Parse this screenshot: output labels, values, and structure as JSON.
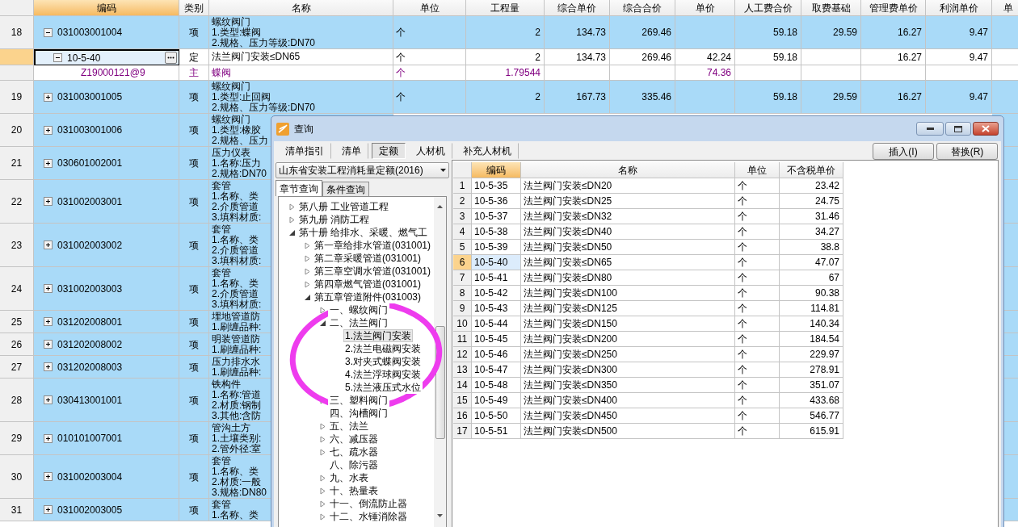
{
  "table": {
    "columns": [
      {
        "label": "编码",
        "selected": true
      },
      {
        "label": "类别",
        "selected": false
      },
      {
        "label": "名称",
        "selected": false
      },
      {
        "label": "单位",
        "selected": false
      },
      {
        "label": "工程量",
        "selected": false
      },
      {
        "label": "综合单价",
        "selected": false
      },
      {
        "label": "综合合价",
        "selected": false
      },
      {
        "label": "单价",
        "selected": false
      },
      {
        "label": "人工费合价",
        "selected": false
      },
      {
        "label": "取费基础",
        "selected": false
      },
      {
        "label": "管理费单价",
        "selected": false
      },
      {
        "label": "利润单价",
        "selected": false
      },
      {
        "label": "单",
        "selected": false
      }
    ],
    "rows": [
      {
        "num": "18",
        "kind": "item",
        "expanded": true,
        "code": "031003001004",
        "type": "项",
        "lines": [
          "螺纹阀门",
          "1.类型:蝶阀",
          "2.规格、压力等级:DN70"
        ],
        "unit": "个",
        "values": {
          "quantity": "2",
          "composite_price": "134.73",
          "composite_total": "269.46",
          "labor_total": "59.18",
          "fee_base": "29.59",
          "management_fee": "16.27",
          "profit": "9.47"
        }
      },
      {
        "kind": "quota",
        "current": true,
        "focused": true,
        "expanded": true,
        "code": "10-5-40",
        "type": "定",
        "lines": [
          "法兰阀门安装≤DN65"
        ],
        "unit": "个",
        "values": {
          "quantity": "2",
          "composite_price": "134.73",
          "composite_total": "269.46",
          "unit_price": "42.24",
          "labor_total": "59.18",
          "management_fee": "16.27",
          "profit": "9.47"
        }
      },
      {
        "kind": "material",
        "code": "Z19000121@9",
        "type": "主",
        "lines": [
          "蝶阀"
        ],
        "unit": "个",
        "values": {
          "quantity": "1.79544",
          "unit_price": "74.36"
        }
      },
      {
        "num": "19",
        "kind": "item",
        "expanded": false,
        "code": "031003001005",
        "type": "项",
        "lines": [
          "螺纹阀门",
          "1.类型:止回阀",
          "2.规格、压力等级:DN70"
        ],
        "unit": "个",
        "values": {
          "quantity": "2",
          "composite_price": "167.73",
          "composite_total": "335.46",
          "labor_total": "59.18",
          "fee_base": "29.59",
          "management_fee": "16.27",
          "profit": "9.47"
        }
      },
      {
        "num": "20",
        "kind": "item",
        "expanded": false,
        "code": "031003001006",
        "type": "项",
        "lines": [
          "螺纹阀门",
          "1.类型:橡胶",
          "2.规格、压力"
        ]
      },
      {
        "num": "21",
        "kind": "item",
        "expanded": false,
        "code": "030601002001",
        "type": "项",
        "lines": [
          "压力仪表",
          "1.名称:压力",
          "2.规格:DN70"
        ]
      },
      {
        "num": "22",
        "kind": "item",
        "expanded": false,
        "code": "031002003001",
        "type": "项",
        "lines": [
          "套管",
          "1.名称、类",
          "2.介质管道",
          "3.填料材质:"
        ]
      },
      {
        "num": "23",
        "kind": "item",
        "expanded": false,
        "code": "031002003002",
        "type": "项",
        "lines": [
          "套管",
          "1.名称、类",
          "2.介质管道",
          "3.填料材质:"
        ]
      },
      {
        "num": "24",
        "kind": "item",
        "expanded": false,
        "code": "031002003003",
        "type": "项",
        "lines": [
          "套管",
          "1.名称、类",
          "2.介质管道",
          "3.填料材质:"
        ]
      },
      {
        "num": "25",
        "kind": "item",
        "expanded": false,
        "code": "031202008001",
        "type": "项",
        "lines": [
          "埋地管道防",
          "1.刷缠品种:"
        ]
      },
      {
        "num": "26",
        "kind": "item",
        "expanded": false,
        "code": "031202008002",
        "type": "项",
        "lines": [
          "明装管道防",
          "1.刷缠品种:"
        ]
      },
      {
        "num": "27",
        "kind": "item",
        "expanded": false,
        "code": "031202008003",
        "type": "项",
        "lines": [
          "压力排水水",
          "1.刷缠品种:"
        ]
      },
      {
        "num": "28",
        "kind": "item",
        "expanded": false,
        "code": "030413001001",
        "type": "项",
        "lines": [
          "铁构件",
          "1.名称:管道",
          "2.材质:钢制",
          "3.其他:含防"
        ]
      },
      {
        "num": "29",
        "kind": "item",
        "expanded": false,
        "code": "010101007001",
        "type": "项",
        "lines": [
          "管沟土方",
          "1.土壤类别:",
          "2.管外径:室"
        ]
      },
      {
        "num": "30",
        "kind": "item",
        "expanded": false,
        "code": "031002003004",
        "type": "项",
        "lines": [
          "套管",
          "1.名称、类",
          "2.材质:一般",
          "3.规格:DN80"
        ]
      },
      {
        "num": "31",
        "kind": "item",
        "expanded": false,
        "code": "031002003005",
        "type": "项",
        "lines": [
          "套管",
          "1.名称、类"
        ]
      }
    ]
  },
  "dialog": {
    "title": "查询",
    "tabs": [
      {
        "label": "清单指引",
        "selected": false
      },
      {
        "label": "清单",
        "selected": false
      },
      {
        "label": "定额",
        "selected": true
      },
      {
        "label": "人材机",
        "selected": false
      },
      {
        "label": "补充人材机",
        "selected": false
      }
    ],
    "buttons": [
      "插入(I)",
      "替换(R)"
    ],
    "library": "山东省安装工程消耗量定额(2016)",
    "search_tabs": [
      {
        "label": "章节查询",
        "selected": true
      },
      {
        "label": "条件查询",
        "selected": false
      }
    ],
    "tree": [
      {
        "label": "第八册  工业管道工程",
        "selected": false,
        "expanded": false
      },
      {
        "label": "第九册  消防工程",
        "selected": false,
        "expanded": false
      },
      {
        "label": "第十册  给排水、采暖、燃气工",
        "selected": false,
        "expanded": true,
        "children": [
          {
            "label": "第一章给排水管道(031001)",
            "selected": false,
            "expanded": false
          },
          {
            "label": "第二章采暖管道(031001)",
            "selected": false,
            "expanded": false
          },
          {
            "label": "第三章空调水管道(031001)",
            "selected": false,
            "expanded": false
          },
          {
            "label": "第四章燃气管道(031001)",
            "selected": false,
            "expanded": false
          },
          {
            "label": "第五章管道附件(031003)",
            "selected": false,
            "expanded": true,
            "children": [
              {
                "label": "一、螺纹阀门",
                "selected": false,
                "expanded": false
              },
              {
                "label": "二、法兰阀门",
                "selected": false,
                "expanded": true,
                "children": [
                  {
                    "label": "1.法兰阀门安装",
                    "selected": true
                  },
                  {
                    "label": "2.法兰电磁阀安装",
                    "selected": false
                  },
                  {
                    "label": "3.对夹式蝶阀安装",
                    "selected": false
                  },
                  {
                    "label": "4.法兰浮球阀安装",
                    "selected": false
                  },
                  {
                    "label": "5.法兰液压式水位",
                    "selected": false
                  }
                ]
              },
              {
                "label": "三、塑料阀门",
                "selected": false,
                "expanded": false
              },
              {
                "label": "四、沟槽阀门",
                "selected": false
              },
              {
                "label": "五、法兰",
                "selected": false,
                "expanded": false
              },
              {
                "label": "六、减压器",
                "selected": false,
                "expanded": false
              },
              {
                "label": "七、疏水器",
                "selected": false,
                "expanded": false
              },
              {
                "label": "八、除污器",
                "selected": false
              },
              {
                "label": "九、水表",
                "selected": false,
                "expanded": false
              },
              {
                "label": "十、热量表",
                "selected": false,
                "expanded": false
              },
              {
                "label": "十一、倒流防止器",
                "selected": false,
                "expanded": false
              },
              {
                "label": "十二、水锤消除器",
                "selected": false,
                "expanded": false
              }
            ]
          }
        ]
      }
    ],
    "grid": {
      "columns": [
        {
          "label": "编码",
          "selected": true
        },
        {
          "label": "名称",
          "selected": false
        },
        {
          "label": "单位",
          "selected": false
        },
        {
          "label": "不含税单价",
          "selected": false
        }
      ],
      "rows": [
        {
          "num": "1",
          "code": "10-5-35",
          "name": "法兰阀门安装≤DN20",
          "unit": "个",
          "price": "23.42",
          "selected": false
        },
        {
          "num": "2",
          "code": "10-5-36",
          "name": "法兰阀门安装≤DN25",
          "unit": "个",
          "price": "24.75",
          "selected": false
        },
        {
          "num": "3",
          "code": "10-5-37",
          "name": "法兰阀门安装≤DN32",
          "unit": "个",
          "price": "31.46",
          "selected": false
        },
        {
          "num": "4",
          "code": "10-5-38",
          "name": "法兰阀门安装≤DN40",
          "unit": "个",
          "price": "34.27",
          "selected": false
        },
        {
          "num": "5",
          "code": "10-5-39",
          "name": "法兰阀门安装≤DN50",
          "unit": "个",
          "price": "38.8",
          "selected": false
        },
        {
          "num": "6",
          "code": "10-5-40",
          "name": "法兰阀门安装≤DN65",
          "unit": "个",
          "price": "47.07",
          "selected": true
        },
        {
          "num": "7",
          "code": "10-5-41",
          "name": "法兰阀门安装≤DN80",
          "unit": "个",
          "price": "67",
          "selected": false
        },
        {
          "num": "8",
          "code": "10-5-42",
          "name": "法兰阀门安装≤DN100",
          "unit": "个",
          "price": "90.38",
          "selected": false
        },
        {
          "num": "9",
          "code": "10-5-43",
          "name": "法兰阀门安装≤DN125",
          "unit": "个",
          "price": "114.81",
          "selected": false
        },
        {
          "num": "10",
          "code": "10-5-44",
          "name": "法兰阀门安装≤DN150",
          "unit": "个",
          "price": "140.34",
          "selected": false
        },
        {
          "num": "11",
          "code": "10-5-45",
          "name": "法兰阀门安装≤DN200",
          "unit": "个",
          "price": "184.54",
          "selected": false
        },
        {
          "num": "12",
          "code": "10-5-46",
          "name": "法兰阀门安装≤DN250",
          "unit": "个",
          "price": "229.97",
          "selected": false
        },
        {
          "num": "13",
          "code": "10-5-47",
          "name": "法兰阀门安装≤DN300",
          "unit": "个",
          "price": "278.91",
          "selected": false
        },
        {
          "num": "14",
          "code": "10-5-48",
          "name": "法兰阀门安装≤DN350",
          "unit": "个",
          "price": "351.07",
          "selected": false
        },
        {
          "num": "15",
          "code": "10-5-49",
          "name": "法兰阀门安装≤DN400",
          "unit": "个",
          "price": "433.68",
          "selected": false
        },
        {
          "num": "16",
          "code": "10-5-50",
          "name": "法兰阀门安装≤DN450",
          "unit": "个",
          "price": "546.77",
          "selected": false
        },
        {
          "num": "17",
          "code": "10-5-51",
          "name": "法兰阀门安装≤DN500",
          "unit": "个",
          "price": "615.91",
          "selected": false
        }
      ]
    }
  },
  "annotations": [
    {
      "kind": "ellipse"
    }
  ]
}
